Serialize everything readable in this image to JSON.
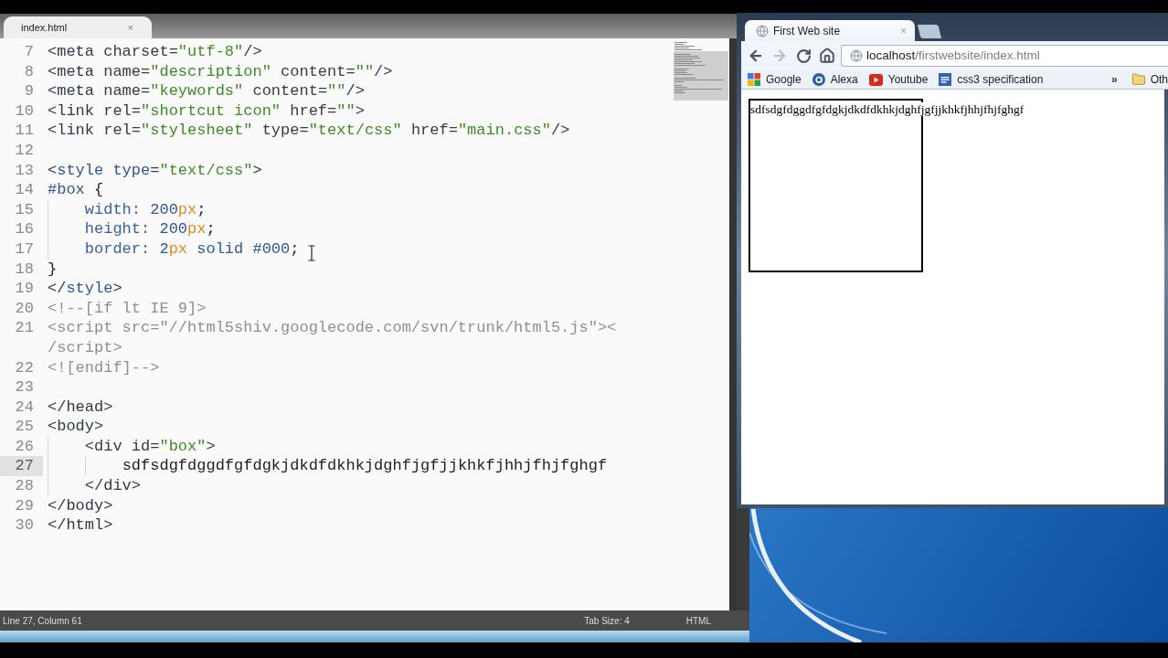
{
  "editor": {
    "tabs": [
      {
        "label": "index.html",
        "close": "×",
        "selected": true
      }
    ],
    "lines": [
      {
        "number": "7",
        "current": false,
        "tokens": [
          {
            "kind": "tag",
            "text": "<meta"
          },
          {
            "kind": "attr",
            "text": " charset="
          },
          {
            "kind": "string",
            "text": "\"utf-8\""
          },
          {
            "kind": "tag",
            "text": "/>"
          }
        ]
      },
      {
        "number": "8",
        "current": false,
        "tokens": [
          {
            "kind": "tag",
            "text": "<meta"
          },
          {
            "kind": "attr",
            "text": " name="
          },
          {
            "kind": "string",
            "text": "\"description\""
          },
          {
            "kind": "attr",
            "text": " content="
          },
          {
            "kind": "string",
            "text": "\"\""
          },
          {
            "kind": "tag",
            "text": "/>"
          }
        ]
      },
      {
        "number": "9",
        "current": false,
        "tokens": [
          {
            "kind": "tag",
            "text": "<meta"
          },
          {
            "kind": "attr",
            "text": " name="
          },
          {
            "kind": "string",
            "text": "\"keywords\""
          },
          {
            "kind": "attr",
            "text": " content="
          },
          {
            "kind": "string",
            "text": "\"\""
          },
          {
            "kind": "tag",
            "text": "/>"
          }
        ]
      },
      {
        "number": "10",
        "current": false,
        "tokens": [
          {
            "kind": "tag",
            "text": "<link"
          },
          {
            "kind": "attr",
            "text": " rel="
          },
          {
            "kind": "string",
            "text": "\"shortcut icon\""
          },
          {
            "kind": "attr",
            "text": " href="
          },
          {
            "kind": "string",
            "text": "\"\""
          },
          {
            "kind": "tag",
            "text": ">"
          }
        ]
      },
      {
        "number": "11",
        "current": false,
        "tokens": [
          {
            "kind": "tag",
            "text": "<link"
          },
          {
            "kind": "attr",
            "text": " rel="
          },
          {
            "kind": "string",
            "text": "\"stylesheet\""
          },
          {
            "kind": "attr",
            "text": " type="
          },
          {
            "kind": "string",
            "text": "\"text/css\""
          },
          {
            "kind": "attr",
            "text": " href="
          },
          {
            "kind": "string",
            "text": "\"main.css\""
          },
          {
            "kind": "tag",
            "text": "/>"
          }
        ]
      },
      {
        "number": "12",
        "current": false
      },
      {
        "number": "13",
        "current": false,
        "tokens": [
          {
            "kind": "tag",
            "text": "<"
          },
          {
            "kind": "keyword",
            "text": "style type"
          },
          {
            "kind": "tag",
            "text": "="
          },
          {
            "kind": "string",
            "text": "\"text/css\""
          },
          {
            "kind": "tag",
            "text": ">"
          }
        ]
      },
      {
        "number": "14",
        "current": false,
        "tokens": [
          {
            "kind": "keyword",
            "text": "#box"
          },
          {
            "kind": "plain",
            "text": " {"
          }
        ]
      },
      {
        "number": "15",
        "current": false,
        "tokens": [
          {
            "kind": "prop",
            "text": "    width:"
          },
          {
            "kind": "number",
            "text": " 200"
          },
          {
            "kind": "unit",
            "text": "px"
          },
          {
            "kind": "plain",
            "text": ";"
          }
        ]
      },
      {
        "number": "16",
        "current": false,
        "tokens": [
          {
            "kind": "prop",
            "text": "    height:"
          },
          {
            "kind": "number",
            "text": " 200"
          },
          {
            "kind": "unit",
            "text": "px"
          },
          {
            "kind": "plain",
            "text": ";"
          }
        ]
      },
      {
        "number": "17",
        "current": false,
        "tokens": [
          {
            "kind": "prop",
            "text": "    border:"
          },
          {
            "kind": "number",
            "text": " 2"
          },
          {
            "kind": "unit",
            "text": "px"
          },
          {
            "kind": "number",
            "text": " solid #000"
          },
          {
            "kind": "plain",
            "text": ";"
          }
        ]
      },
      {
        "number": "18",
        "current": false,
        "tokens": [
          {
            "kind": "plain",
            "text": "}"
          }
        ]
      },
      {
        "number": "19",
        "current": false,
        "tokens": [
          {
            "kind": "tag",
            "text": "</"
          },
          {
            "kind": "keyword",
            "text": "style"
          },
          {
            "kind": "tag",
            "text": ">"
          }
        ]
      },
      {
        "number": "20",
        "current": false,
        "tokens": [
          {
            "kind": "comment",
            "text": "<!--[if lt IE 9]>"
          }
        ]
      },
      {
        "number": "21",
        "current": false,
        "tokens": [
          {
            "kind": "comment",
            "text": "<script src=\"//html5shiv.googlecode.com/svn/trunk/html5.js\"><"
          }
        ],
        "wrap": [
          {
            "kind": "comment",
            "text": "/script>"
          }
        ]
      },
      {
        "number": "22",
        "current": false,
        "tokens": [
          {
            "kind": "comment",
            "text": "<![endif]-->"
          }
        ]
      },
      {
        "number": "23",
        "current": false
      },
      {
        "number": "24",
        "current": false,
        "tokens": [
          {
            "kind": "tag",
            "text": "</head>"
          }
        ]
      },
      {
        "number": "25",
        "current": false,
        "tokens": [
          {
            "kind": "tag",
            "text": "<body>"
          }
        ]
      },
      {
        "number": "26",
        "current": false,
        "tokens": [
          {
            "kind": "tag",
            "text": "    <div"
          },
          {
            "kind": "attr",
            "text": " id="
          },
          {
            "kind": "string",
            "text": "\"box\""
          },
          {
            "kind": "tag",
            "text": ">"
          }
        ]
      },
      {
        "number": "27",
        "current": true,
        "tokens": [
          {
            "kind": "plain",
            "text": "        sdfsdgfdggdfgfdgkjdkdfdkhkjdghfjgfjjkhkfjhhjfhjfghgf"
          }
        ]
      },
      {
        "number": "28",
        "current": false,
        "tokens": [
          {
            "kind": "tag",
            "text": "    </div>"
          }
        ]
      },
      {
        "number": "29",
        "current": false,
        "tokens": [
          {
            "kind": "tag",
            "text": "</body>"
          }
        ]
      },
      {
        "number": "30",
        "current": false,
        "tokens": [
          {
            "kind": "tag",
            "text": "</html>"
          }
        ]
      }
    ],
    "status_bar": {
      "position": "Line 27, Column 61",
      "tab_size": "Tab Size: 4",
      "syntax": "HTML"
    }
  },
  "browser": {
    "tabs": [
      {
        "title": "First Web site",
        "close": "×",
        "selected": true
      }
    ],
    "navigation": {
      "back_disabled": false,
      "forward_disabled": true
    },
    "address_bar": {
      "host": "localhost",
      "path": "/firstwebsite/index.html"
    },
    "bookmarks": [
      {
        "label": "Google",
        "kind": "squares"
      },
      {
        "label": "Alexa",
        "kind": "disc"
      },
      {
        "label": "Youtube",
        "kind": "play"
      },
      {
        "label": "css3 specification",
        "kind": "tile"
      }
    ],
    "bookmarks_overflow": "»",
    "other_bookmarks": "Oth",
    "page": {
      "box_text": "sdfsdgfdggdfgfdgkjdkdfdkhkjdghfjgfjjkhkfjhhjfhjfghgf"
    }
  }
}
